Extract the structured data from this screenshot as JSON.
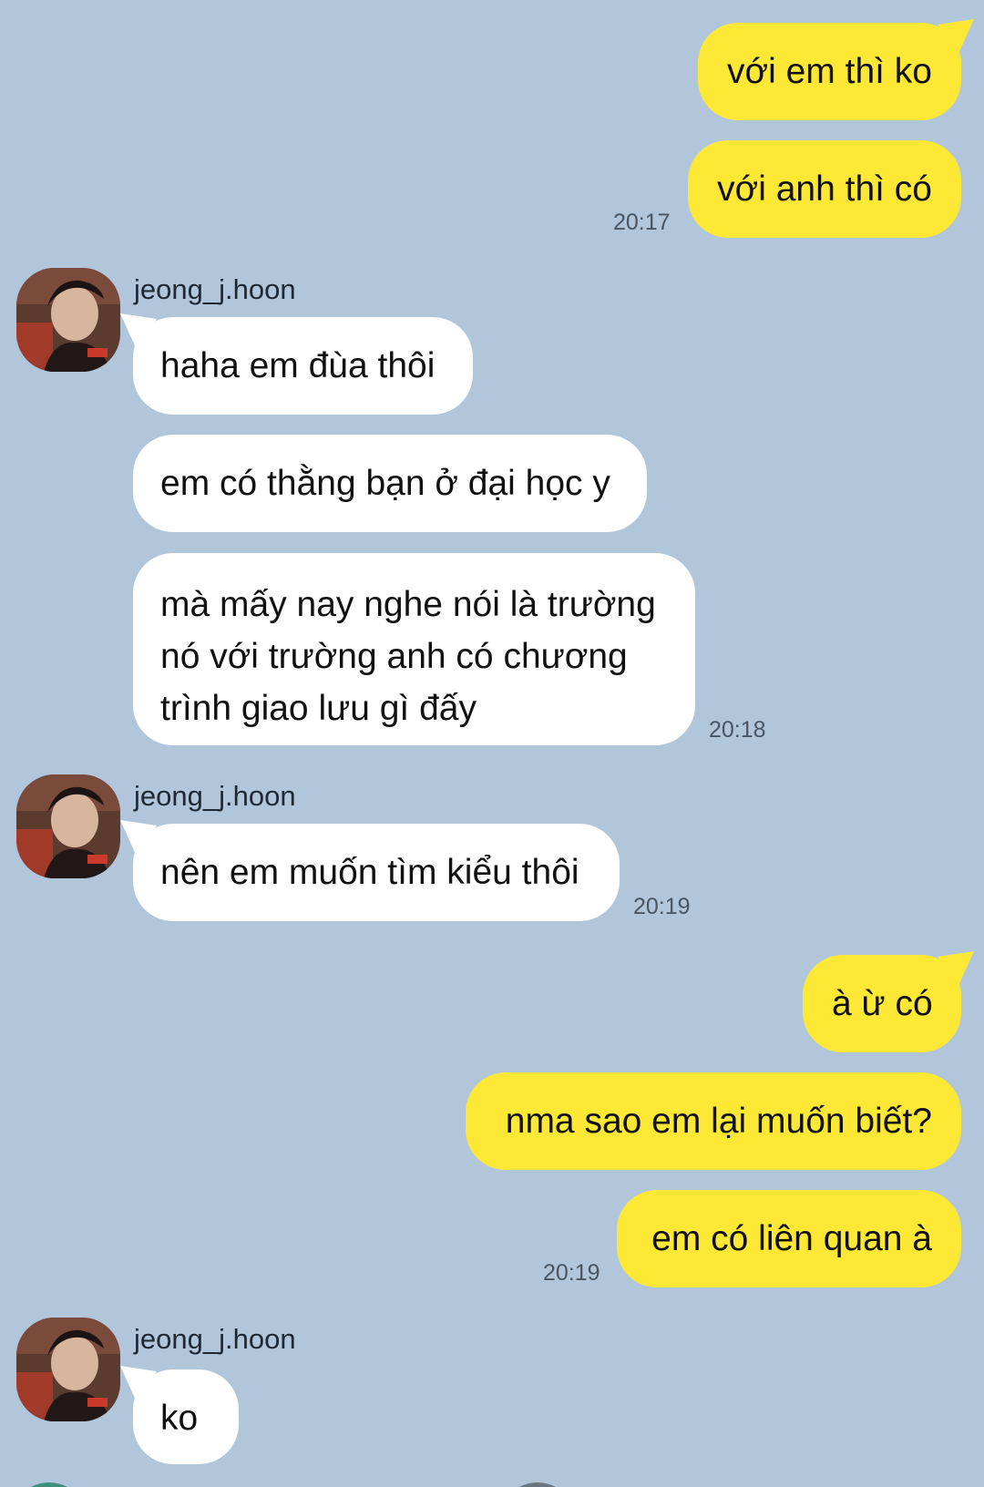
{
  "conversation": {
    "contact_name": "jeong_j.hoon",
    "messages": [
      {
        "direction": "outgoing",
        "text": "với em thì ko"
      },
      {
        "direction": "outgoing",
        "text": "với anh thì có",
        "time": "20:17"
      },
      {
        "direction": "incoming",
        "sender": "jeong_j.hoon",
        "text": "haha em đùa thôi"
      },
      {
        "direction": "incoming",
        "text": "em có thằng bạn ở đại học y"
      },
      {
        "direction": "incoming",
        "text": "mà mấy nay nghe nói là trường nó với trường anh có chương trình giao lưu gì đấy",
        "time": "20:18"
      },
      {
        "direction": "incoming",
        "sender": "jeong_j.hoon",
        "text": "nên em muốn tìm kiểu thôi",
        "time": "20:19"
      },
      {
        "direction": "outgoing",
        "text": "à ừ có"
      },
      {
        "direction": "outgoing",
        "text": "nma sao em lại muốn biết?"
      },
      {
        "direction": "outgoing",
        "text": "em có liên quan à",
        "time": "20:19"
      },
      {
        "direction": "incoming",
        "sender": "jeong_j.hoon",
        "text": "ko"
      }
    ]
  },
  "colors": {
    "background": "#b1c6da",
    "outgoing_bubble": "#fde935",
    "incoming_bubble": "#ffffff",
    "timestamp_text": "#4a5561"
  }
}
